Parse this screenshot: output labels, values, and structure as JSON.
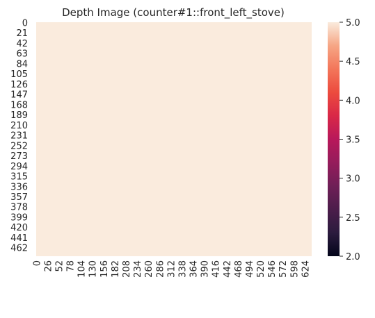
{
  "chart_data": {
    "type": "heatmap",
    "title": "Depth Image (counter#1::front_left_stove)",
    "xlabel": "",
    "ylabel": "",
    "x_tick_labels": [
      "0",
      "26",
      "52",
      "78",
      "104",
      "130",
      "156",
      "182",
      "208",
      "234",
      "260",
      "286",
      "312",
      "338",
      "364",
      "390",
      "416",
      "442",
      "468",
      "494",
      "520",
      "546",
      "572",
      "598",
      "624"
    ],
    "y_tick_labels": [
      "0",
      "21",
      "42",
      "63",
      "84",
      "105",
      "126",
      "147",
      "168",
      "189",
      "210",
      "231",
      "252",
      "273",
      "294",
      "315",
      "336",
      "357",
      "378",
      "399",
      "420",
      "441",
      "462"
    ],
    "image_width": 640,
    "image_height": 480,
    "values": "uniform",
    "uniform_value": 5.0,
    "colorbar": {
      "colormap": "rocket",
      "vmin": 2.0,
      "vmax": 5.0,
      "tick_labels": [
        "2.0",
        "2.5",
        "3.0",
        "3.5",
        "4.0",
        "4.5",
        "5.0"
      ]
    },
    "max_color": "#faebdd",
    "grid": false
  }
}
